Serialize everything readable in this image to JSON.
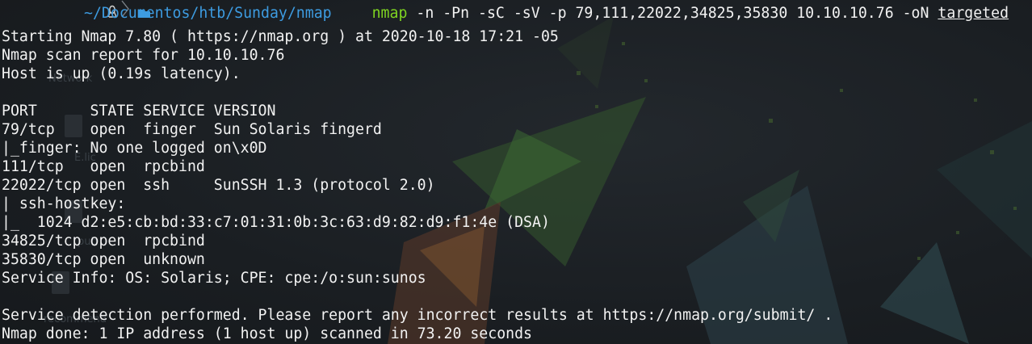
{
  "prompt": {
    "os_icon": "linux-tux-icon",
    "separator_icon": "chevron-right-icon",
    "folder_icon": "folder-icon",
    "path": "~/Documentos/htb/Sunday/nmap",
    "command": "nmap",
    "args": " -n -Pn -sC -sV -p 79,111,22022,34825,35830 10.10.10.76 -oN ",
    "output_file": "targeted",
    "colors": {
      "path": "#3d9be0",
      "command": "#7ed321",
      "text": "#f2f2f2",
      "background": "#1c2024"
    }
  },
  "output": [
    "Starting Nmap 7.80 ( https://nmap.org ) at 2020-10-18 17:21 -05",
    "Nmap scan report for 10.10.10.76",
    "Host is up (0.19s latency).",
    "",
    "PORT      STATE SERVICE VERSION",
    "79/tcp    open  finger  Sun Solaris fingerd",
    "|_finger: No one logged on\\x0D",
    "111/tcp   open  rpcbind",
    "22022/tcp open  ssh     SunSSH 1.3 (protocol 2.0)",
    "| ssh-hostkey: ",
    "|_  1024 d2:e5:cb:bd:33:c7:01:31:0b:3c:63:d9:82:d9:f1:4e (DSA)",
    "34825/tcp open  rpcbind",
    "35830/tcp open  unknown",
    "Service Info: OS: Solaris; CPE: cpe:/o:sun:sunos",
    "",
    "Service detection performed. Please report any incorrect results at https://nmap.org/submit/ .",
    "Nmap done: 1 IP address (1 host up) scanned in 73.20 seconds"
  ],
  "background_ghosts": {
    "labels": [
      "Network",
      "E.lic",
      "pub",
      "recommend"
    ]
  }
}
